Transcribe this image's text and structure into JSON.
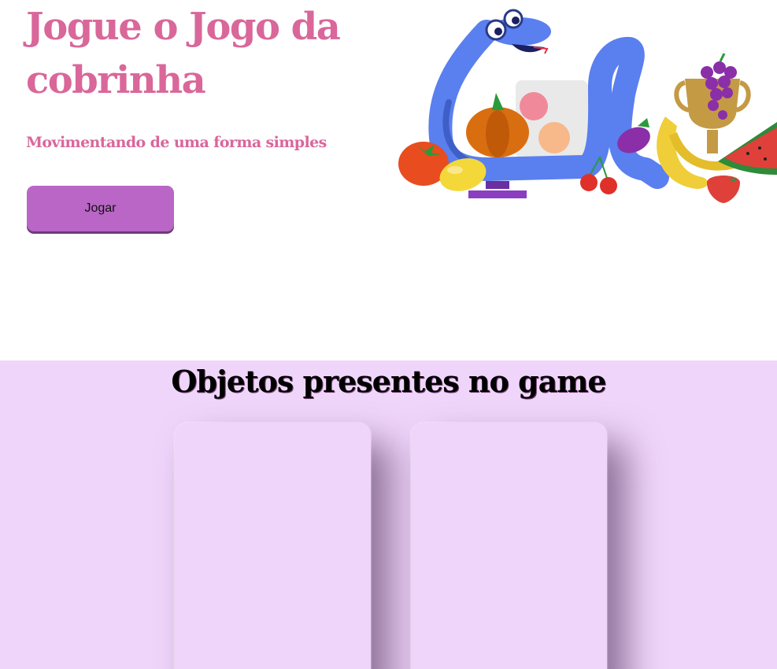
{
  "hero": {
    "title": "Jogue o Jogo da cobrinha",
    "subtitle": "Movimentando de uma forma simples",
    "play_label": "Jogar",
    "illustration": "snake-with-fruits-illustration"
  },
  "objects": {
    "title": "Objetos presentes no game",
    "cards": [
      {},
      {}
    ]
  },
  "colors": {
    "accent": "#d9679a",
    "button": "#b966c6",
    "section_bg": "#f0d5fb",
    "snake": "#5a7fef"
  }
}
